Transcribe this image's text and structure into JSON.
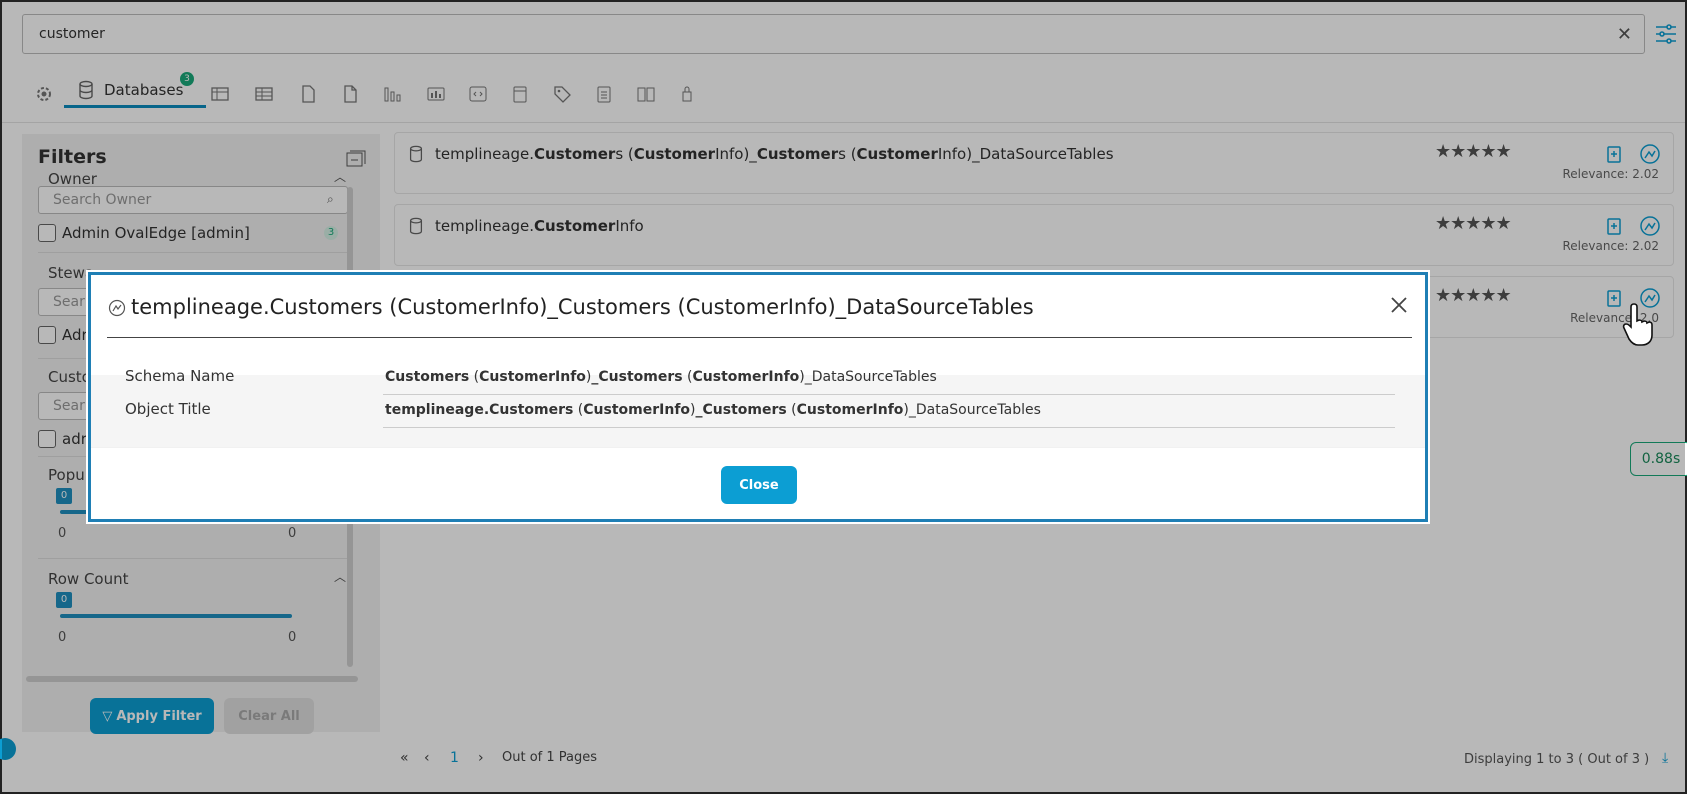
{
  "search": {
    "value": "customer"
  },
  "tabs": {
    "databases_label": "Databases",
    "databases_count": "3"
  },
  "filters": {
    "title": "Filters",
    "owner": {
      "label": "Owner",
      "placeholder": "Search Owner",
      "option": "Admin OvalEdge [admin]",
      "option_count": "3"
    },
    "steward": {
      "label": "Stewa",
      "placeholder": "Sear",
      "option": "Adr"
    },
    "custom": {
      "label": "Custo",
      "placeholder": "Sear",
      "option": "adr"
    },
    "popularity": {
      "label": "Popul",
      "tip": "0",
      "min": "0",
      "max": "0"
    },
    "rowcount": {
      "label": "Row Count",
      "tip": "0",
      "min": "0",
      "max": "0"
    },
    "apply_label": "Apply Filter",
    "clear_label": "Clear All"
  },
  "results": [
    {
      "prefix": "templineage.",
      "b1": "Customer",
      "t1": "s (",
      "b2": "Customer",
      "t2": "Info)_",
      "b3": "Customer",
      "t3": "s (",
      "b4": "Customer",
      "t4": "Info)_DataSourceTables",
      "stars": "★★★★★",
      "relevance": "Relevance:  2.02"
    },
    {
      "prefix": "templineage.",
      "b1": "Customer",
      "t1": "Info",
      "b2": "",
      "t2": "",
      "b3": "",
      "t3": "",
      "b4": "",
      "t4": "",
      "stars": "★★★★★",
      "relevance": "Relevance:  2.02"
    },
    {
      "prefix": "",
      "b1": "",
      "t1": "",
      "b2": "",
      "t2": "",
      "b3": "",
      "t3": "",
      "b4": "",
      "t4": "",
      "stars": "★★★★★",
      "relevance": "Relevance:  2.0"
    }
  ],
  "timer": "0.88s",
  "pager": {
    "page": "1",
    "out_of": "Out of 1 Pages",
    "displaying": "Displaying  1  to  3 ( Out of  3 )"
  },
  "modal": {
    "title": "templineage.Customers (CustomerInfo)_Customers (CustomerInfo)_DataSourceTables",
    "schema_label": "Schema Name",
    "schema_b1": "Customers",
    "schema_t1": " (",
    "schema_b2": "CustomerInfo",
    "schema_t2": ")",
    "schema_b3": "_Customers",
    "schema_t3": " (",
    "schema_b4": "CustomerInfo",
    "schema_t4": ")_DataSourceTables",
    "object_label": "Object Title",
    "object_b1": "templineage.Customers",
    "object_t1": " (",
    "object_b2": "CustomerInfo",
    "object_t2": ")",
    "object_b3": "_Customers",
    "object_t3": " (",
    "object_b4": "CustomerInfo",
    "object_t4": ")_DataSourceTables",
    "close_label": "Close"
  }
}
